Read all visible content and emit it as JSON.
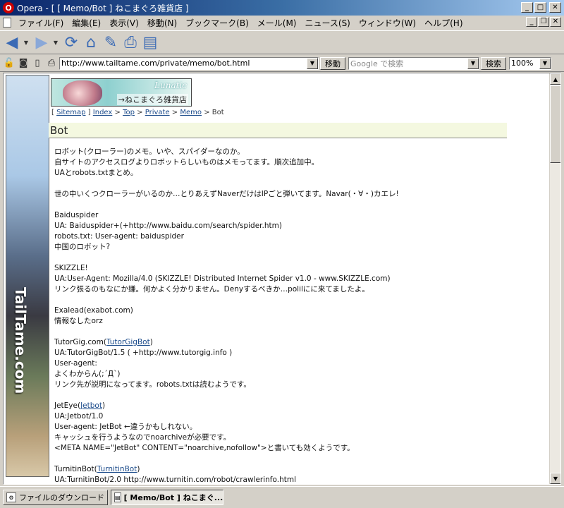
{
  "window": {
    "title": "Opera - [ [ Memo/Bot ] ねこまぐろ雑貨店 ]",
    "logo": "O"
  },
  "menu": [
    "ファイル(F)",
    "編集(E)",
    "表示(V)",
    "移動(N)",
    "ブックマーク(B)",
    "メール(M)",
    "ニュース(S)",
    "ウィンドウ(W)",
    "ヘルプ(H)"
  ],
  "toolbar": {
    "icons": [
      "back-arrow-icon",
      "forward-arrow-icon",
      "reload-icon",
      "home-icon",
      "hotlist-icon",
      "print-icon",
      "document-icon"
    ]
  },
  "address": {
    "url": "http://www.tailtame.com/private/memo/bot.html",
    "go_label": "移動",
    "search_placeholder": "Google で検索",
    "search_label": "検索",
    "zoom": "100%"
  },
  "page": {
    "banner_brand": "Lunatic",
    "banner_shop": "→ねこまぐろ雑貨店",
    "side_logo": "TailTame.com",
    "crumbs": {
      "open": "[",
      "sitemap": "Sitemap",
      "sep1": "]",
      "index": "Index",
      "gt1": ">",
      "top": "Top",
      "gt2": ">",
      "private": "Private",
      "gt3": ">",
      "memo": "Memo",
      "gt4": ">",
      "current": "Bot"
    },
    "heading": "Bot",
    "intro": [
      "ロボット(クローラー)のメモ。いや、スパイダーなのか。",
      "自サイトのアクセスログよりロボットらしいものはメモってます。順次追加中。",
      "UAとrobots.txtまとめ。"
    ],
    "intro2": "世の中いくつクローラーがいるのか…とりあえずNaverだけはIPごと弾いてます。Navar(・∀・)カエレ!",
    "baidu": [
      "Baiduspider",
      "UA: Baiduspider+(+http://www.baidu.com/search/spider.htm)",
      "robots.txt: User-agent: baiduspider",
      "中国のロボット?"
    ],
    "skizzle": [
      "SKIZZLE!",
      "UA:User-Agent: Mozilla/4.0 (SKIZZLE! Distributed Internet Spider v1.0 - www.SKIZZLE.com)",
      "リンク張るのもなにか嫌。何かよく分かりません。Denyするべきか…polilにに来てましたよ。"
    ],
    "exalead": [
      "Exalead(exabot.com)",
      "情報なしたorz"
    ],
    "tutorgig": {
      "name": "TutorGig.com(",
      "link": "TutorGigBot",
      "close": ")",
      "lines": [
        "UA:TutorGigBot/1.5 ( +http://www.tutorgig.info )",
        "User-agent:",
        "よくわからん(;´Д`)",
        "リンク先が説明になってます。robots.txtは読むようです。"
      ]
    },
    "jeteye": {
      "name": "JetEye(",
      "link": "Jetbot",
      "close": ")",
      "lines": [
        "UA:Jetbot/1.0",
        "User-agent: JetBot ←違うかもしれない。",
        "キャッシュを行うようなのでnoarchiveが必要です。",
        "<META NAME=\"JetBot\" CONTENT=\"noarchive,nofollow\">と書いても効くようです。"
      ]
    },
    "turnitin": {
      "name": "TurnitinBot(",
      "link": "TurnitinBot",
      "close": ")",
      "lines": [
        "UA:TurnitinBot/2.0 http://www.turnitin.com/robot/crawlerinfo.html"
      ]
    }
  },
  "taskbar": {
    "downloads": "ファイルのダウンロード",
    "active_tab": "[ Memo/Bot ] ねこまぐ..."
  }
}
